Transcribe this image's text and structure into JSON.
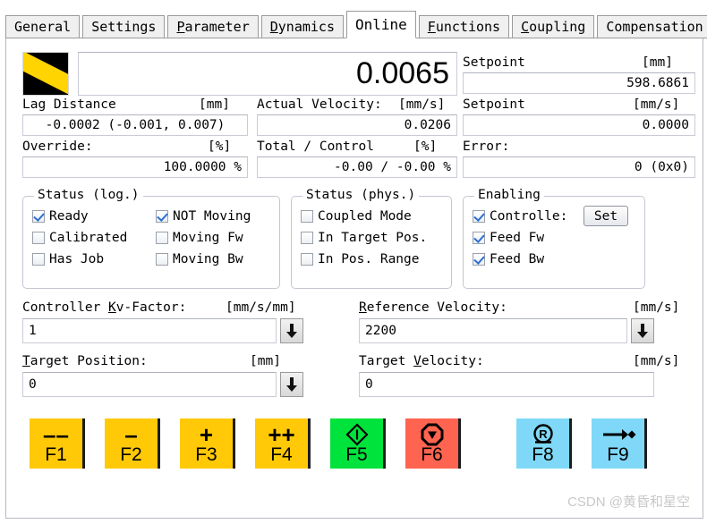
{
  "tabs": [
    {
      "label": "General",
      "accel": "",
      "active": false
    },
    {
      "label": "Settings",
      "accel": "",
      "active": false
    },
    {
      "label": "Parameter",
      "accel": "P",
      "active": false
    },
    {
      "label": "Dynamics",
      "accel": "D",
      "active": false
    },
    {
      "label": "Online",
      "accel": "",
      "active": true
    },
    {
      "label": "Functions",
      "accel": "F",
      "active": false
    },
    {
      "label": "Coupling",
      "accel": "C",
      "active": false
    },
    {
      "label": "Compensation",
      "accel": "",
      "active": false
    }
  ],
  "readouts": {
    "actual_position_value": "0.0065",
    "setpoint_position_label": "Setpoint",
    "setpoint_position_unit": "[mm]",
    "setpoint_position_value": "598.6861",
    "lag_distance_label": "Lag Distance",
    "lag_distance_unit": "[mm]",
    "lag_distance_value": "-0.0002   (-0.001, 0.007)",
    "actual_velocity_label": "Actual Velocity:",
    "actual_velocity_unit": "[mm/s]",
    "actual_velocity_value": "0.0206",
    "setpoint_velocity_label": "Setpoint",
    "setpoint_velocity_unit": "[mm/s]",
    "setpoint_velocity_value": "0.0000",
    "override_label": "Override:",
    "override_unit": "[%]",
    "override_value": "100.0000 %",
    "total_control_label": "Total / Control",
    "total_control_unit": "[%]",
    "total_control_value": "-0.00 / -0.00 %",
    "error_label": "Error:",
    "error_value": "0  (0x0)"
  },
  "status_log": {
    "title": "Status (log.)",
    "items_left": [
      {
        "label": "Ready",
        "checked": true
      },
      {
        "label": "Calibrated",
        "checked": false
      },
      {
        "label": "Has Job",
        "checked": false
      }
    ],
    "items_right": [
      {
        "label": "NOT Moving",
        "checked": true
      },
      {
        "label": "Moving Fw",
        "checked": false
      },
      {
        "label": "Moving Bw",
        "checked": false
      }
    ]
  },
  "status_phys": {
    "title": "Status (phys.)",
    "items": [
      {
        "label": "Coupled Mode",
        "checked": false
      },
      {
        "label": "In Target Pos.",
        "checked": false
      },
      {
        "label": "In Pos. Range",
        "checked": false
      }
    ]
  },
  "enabling": {
    "title": "Enabling",
    "items": [
      {
        "label": "Controlle:",
        "checked": true
      },
      {
        "label": "Feed Fw",
        "checked": true
      },
      {
        "label": "Feed Bw",
        "checked": true
      }
    ],
    "set_button": "Set"
  },
  "inputs": {
    "kv_factor": {
      "label_pre": "Controller ",
      "accel": "K",
      "label_post": "v-Factor:",
      "unit": "[mm/s/mm]",
      "value": "1",
      "has_arrow": true
    },
    "reference_velocity": {
      "label_pre": "",
      "accel": "R",
      "label_post": "eference Velocity:",
      "unit": "[mm/s]",
      "value": "2200",
      "has_arrow": true
    },
    "target_position": {
      "label_pre": "",
      "accel": "T",
      "label_post": "arget Position:",
      "unit": "[mm]",
      "value": "0",
      "has_arrow": true
    },
    "target_velocity": {
      "label_pre": "Target ",
      "accel": "V",
      "label_post": "elocity:",
      "unit": "[mm/s]",
      "value": "0",
      "has_arrow": false
    }
  },
  "function_buttons": [
    {
      "key": "F1",
      "glyph": "––",
      "color": "#FFC907",
      "name": "jog-fast-backward"
    },
    {
      "key": "F2",
      "glyph": "–",
      "color": "#FFC907",
      "name": "jog-backward"
    },
    {
      "key": "F3",
      "glyph": "+",
      "color": "#FFC907",
      "name": "jog-forward"
    },
    {
      "key": "F4",
      "glyph": "++",
      "color": "#FFC907",
      "name": "jog-fast-forward"
    },
    {
      "key": "F5",
      "glyph": "start",
      "color": "#00E33C",
      "name": "start"
    },
    {
      "key": "F6",
      "glyph": "stop",
      "color": "#FF6450",
      "name": "stop"
    },
    {
      "key": "F8",
      "glyph": "reset",
      "color": "#7FD8F7",
      "name": "reset"
    },
    {
      "key": "F9",
      "glyph": "move-to-target",
      "color": "#7FD8F7",
      "name": "move-to-target"
    }
  ],
  "watermark": "CSDN @黄昏和星空",
  "colors": {
    "yellow": "#FFC907",
    "green": "#00E33C",
    "red": "#FF6450",
    "blue": "#7FD8F7",
    "check": "#2b6fd4"
  }
}
